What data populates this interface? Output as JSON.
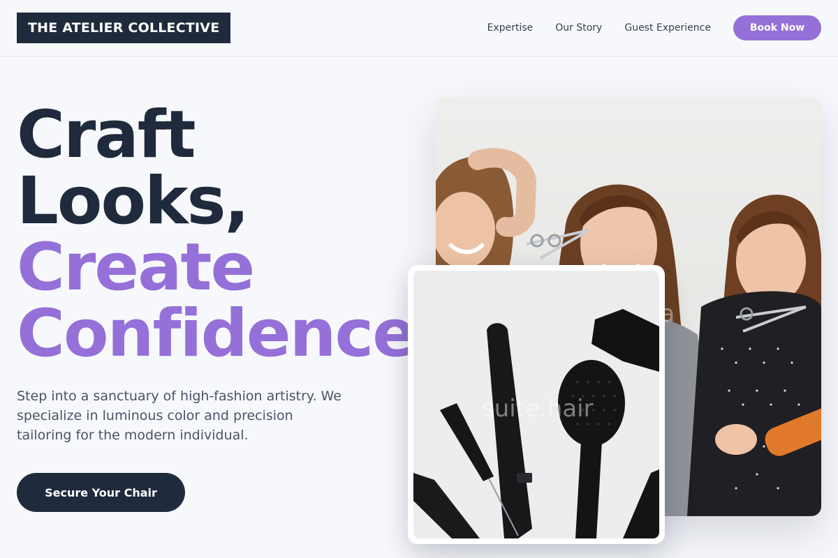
{
  "header": {
    "logo": "THE ATELIER COLLECTIVE",
    "nav": [
      "Expertise",
      "Our Story",
      "Guest Experience"
    ],
    "book_label": "Book Now"
  },
  "hero": {
    "headline_lines": [
      "Craft",
      "Looks,",
      "Create",
      "Confidence."
    ],
    "lead": "Step into a sanctuary of high-fashion artistry. We specialize in luminous color and precision tailoring for the modern individual.",
    "cta_label": "Secure Your Chair"
  },
  "photos": {
    "tools_watermark": "suite.hair",
    "main_watermark": "ha"
  },
  "colors": {
    "accent": "#9470d8",
    "dark": "#1f2a3c",
    "background": "#f7f8fc"
  },
  "icons": {
    "main_photo": "stylists-with-scissors-image",
    "tools_photo": "hair-tools-image"
  }
}
